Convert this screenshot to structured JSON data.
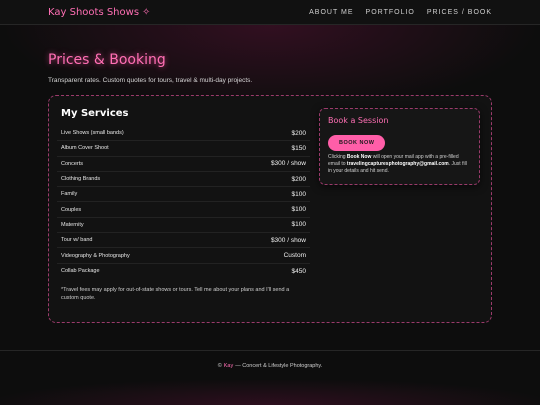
{
  "header": {
    "brand": "Kay Shoots Shows",
    "brand_icon": "sparkle-icon",
    "nav": [
      "ABOUT ME",
      "PORTFOLIO",
      "PRICES / BOOK"
    ]
  },
  "hero": {
    "title": "Prices & Booking",
    "subtitle": "Transparent rates. Custom quotes for tours, travel & multi-day projects."
  },
  "services": {
    "title": "My Services",
    "items": [
      {
        "name": "Live Shows (small bands)",
        "price": "$200"
      },
      {
        "name": "Album Cover Shoot",
        "price": "$150"
      },
      {
        "name": "Concerts",
        "price": "$300 / show"
      },
      {
        "name": "Clothing Brands",
        "price": "$200"
      },
      {
        "name": "Family",
        "price": "$100"
      },
      {
        "name": "Couples",
        "price": "$100"
      },
      {
        "name": "Maternity",
        "price": "$100"
      },
      {
        "name": "Tour w/ band",
        "price": "$300 / show"
      },
      {
        "name": "Videography & Photography",
        "price": "Custom"
      },
      {
        "name": "Collab Package",
        "price": "$450"
      }
    ],
    "note": "*Travel fees may apply for out-of-state shows or tours. Tell me about your plans and I'll send a custom quote."
  },
  "booking": {
    "title": "Book a Session",
    "button": "BOOK NOW",
    "text_pre": "Clicking ",
    "text_bold": "Book Now",
    "text_mid": " will open your mail app with a pre-filled email to ",
    "email": "travelingcapturesphotography@gmail.com",
    "text_post": ". Just fill in your details and hit send."
  },
  "footer": {
    "copyright": "©",
    "name": "Kay",
    "tagline": "— Concert & Lifestyle Photography."
  },
  "colors": {
    "accent": "#ff6fb4",
    "button": "#ff5ea8",
    "background": "#0d0d0d"
  }
}
